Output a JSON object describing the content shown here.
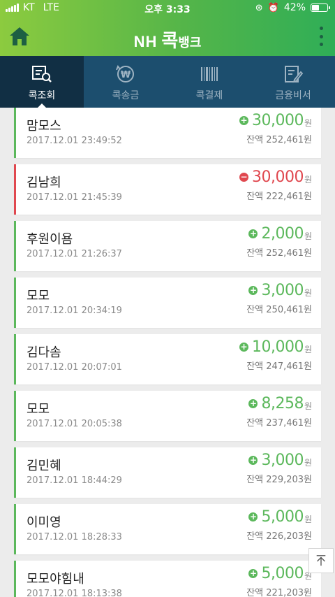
{
  "status": {
    "carrier": "KT",
    "network": "LTE",
    "time": "오후 3:33",
    "battery": "42%"
  },
  "header": {
    "brand_nh": "NH",
    "brand_kok": "콕",
    "brand_bank": "뱅크"
  },
  "tabs": [
    {
      "label": "콕조회",
      "icon": "search-list-icon",
      "active": true
    },
    {
      "label": "콕송금",
      "icon": "won-transfer-icon",
      "active": false
    },
    {
      "label": "콕결제",
      "icon": "barcode-icon",
      "active": false
    },
    {
      "label": "금융비서",
      "icon": "note-pencil-icon",
      "active": false
    }
  ],
  "balance_prefix": "잔액",
  "unit": "원",
  "colors": {
    "accent_green": "#5cb85c",
    "accent_red": "#e0484f",
    "header_green": "#54b549",
    "tab_navy": "#1c4e6e"
  },
  "transactions": [
    {
      "name": "맘모스",
      "datetime": "2017.12.01 23:49:52",
      "amount": "30,000",
      "balance": "252,461원",
      "type": "deposit"
    },
    {
      "name": "김남희",
      "datetime": "2017.12.01 21:45:39",
      "amount": "30,000",
      "balance": "222,461원",
      "type": "withdrawal"
    },
    {
      "name": "후원이욤",
      "datetime": "2017.12.01 21:26:37",
      "amount": "2,000",
      "balance": "252,461원",
      "type": "deposit"
    },
    {
      "name": "모모",
      "datetime": "2017.12.01 20:34:19",
      "amount": "3,000",
      "balance": "250,461원",
      "type": "deposit"
    },
    {
      "name": "김다솜",
      "datetime": "2017.12.01 20:07:01",
      "amount": "10,000",
      "balance": "247,461원",
      "type": "deposit"
    },
    {
      "name": "모모",
      "datetime": "2017.12.01 20:05:38",
      "amount": "8,258",
      "balance": "237,461원",
      "type": "deposit"
    },
    {
      "name": "김민혜",
      "datetime": "2017.12.01 18:44:29",
      "amount": "3,000",
      "balance": "229,203원",
      "type": "deposit"
    },
    {
      "name": "이미영",
      "datetime": "2017.12.01 18:28:33",
      "amount": "5,000",
      "balance": "226,203원",
      "type": "deposit"
    },
    {
      "name": "모모야힘내",
      "datetime": "2017.12.01 18:13:38",
      "amount": "5,000",
      "balance": "221,203원",
      "type": "deposit"
    }
  ]
}
